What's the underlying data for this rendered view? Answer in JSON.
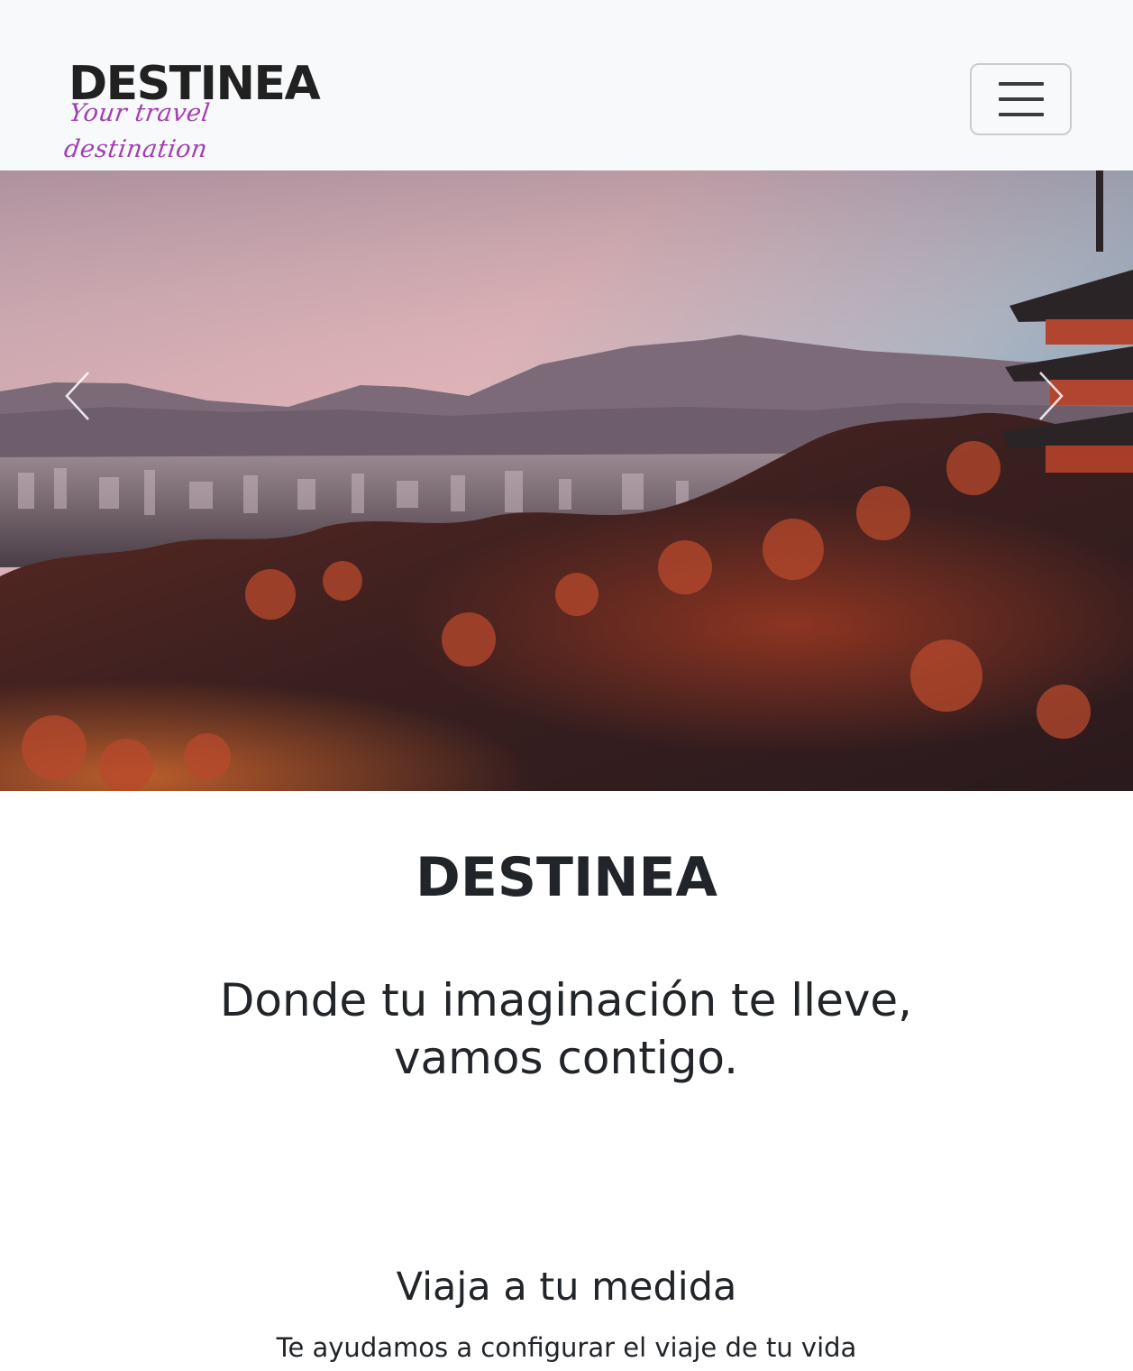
{
  "navbar": {
    "brand_name": "DESTINEA",
    "brand_tagline": "Your travel destination",
    "toggler_icon": "hamburger-menu-icon"
  },
  "carousel": {
    "prev_icon": "chevron-left-icon",
    "next_icon": "chevron-right-icon"
  },
  "main": {
    "title": "DESTINEA",
    "lead_line1": "Donde tu imaginación te lleve,",
    "lead_line2": "vamos contigo.",
    "feature_heading": "Viaja a tu medida",
    "feature_text": "Te ayudamos a configurar el viaje de tu vida"
  },
  "colors": {
    "navbar_bg": "#f8f9fa",
    "tagline": "#a23db4",
    "text": "#212529"
  }
}
